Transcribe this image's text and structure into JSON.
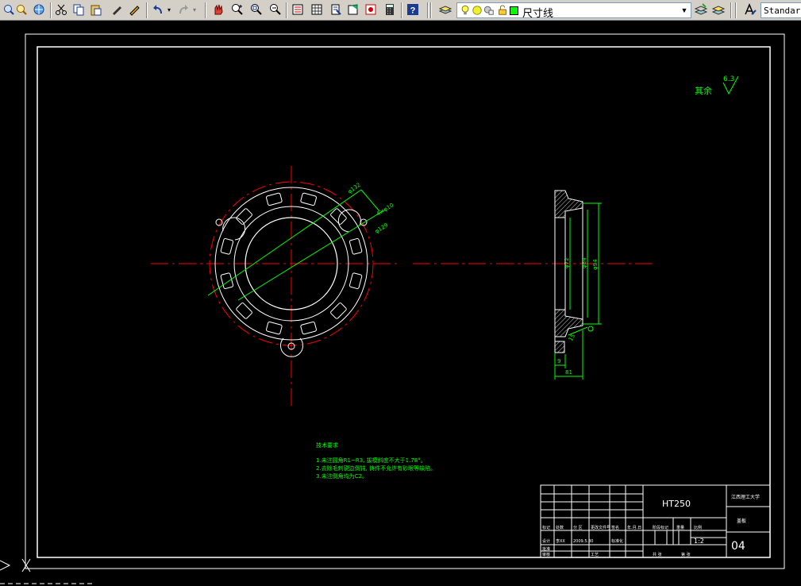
{
  "toolbar": {
    "tools": [
      "zoom-window-icon",
      "pan-realtime-icon",
      "globe-icon",
      "cut-icon",
      "copy-icon",
      "paste-icon",
      "match-properties-icon",
      "block-editor-icon",
      "undo-icon",
      "redo-icon",
      "pan-icon",
      "zoom-realtime-icon",
      "zoom-window-icon",
      "zoom-previous-icon",
      "properties-icon",
      "design-center-icon",
      "tool-palettes-icon",
      "markup-icon",
      "calculator-icon",
      "help-icon",
      "layer-manager-icon"
    ],
    "layer_name": "尺寸线",
    "text_style": "Standard"
  },
  "drawing": {
    "roughness_label": "其余",
    "roughness_value": "6.3",
    "dims_front": [
      "φ132",
      "4×φ10",
      "φ129"
    ],
    "dims_side": [
      "φ72",
      "φ84",
      "φ94",
      "9",
      "81",
      "15"
    ],
    "notes_title": "技术要求",
    "notes": [
      "1.未注圆角R1~R3, 拔模斜度不大于1.78°。",
      "2.去除毛刺锐边倒钝, 铸件不允许有砂眼等缺陷。",
      "3.未注倒角均为C2。"
    ],
    "title_block": {
      "material": "HT250",
      "school": "江西理工大学",
      "part_name": "盖板",
      "scale": "1:2",
      "drawing_no": "04",
      "cells": [
        "标记",
        "处数",
        "分 区",
        "更改文件号",
        "签名",
        "年.月.日",
        "设计",
        "李XX",
        "2009.5.30",
        "标准化",
        "审核",
        "工艺",
        "批准",
        "阶段标记",
        "重量",
        "比例",
        "共 张",
        "第 张"
      ]
    }
  },
  "colors": {
    "background": "#000000",
    "line_white": "#ffffff",
    "line_green": "#00ff00",
    "line_red": "#ff0000"
  }
}
